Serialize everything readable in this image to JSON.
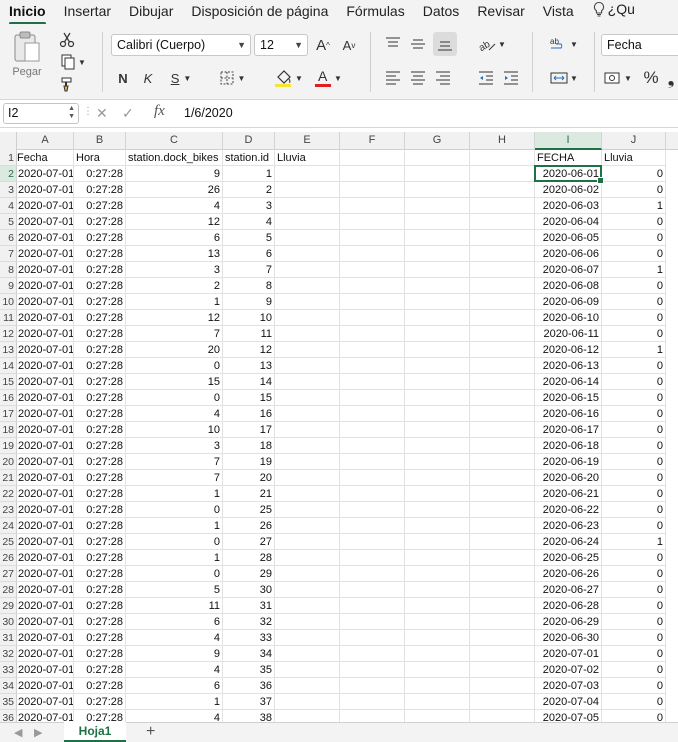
{
  "ribbon_tabs": [
    "Inicio",
    "Insertar",
    "Dibujar",
    "Disposición de página",
    "Fórmulas",
    "Datos",
    "Revisar",
    "Vista"
  ],
  "help_label": "¿Qu",
  "toolbar": {
    "paste_label": "Pegar",
    "font_name": "Calibri (Cuerpo)",
    "font_size": "12",
    "bold": "N",
    "italic": "K",
    "underline": "S",
    "number_format": "Fecha",
    "percent": "%",
    "fill_color": "#f5e52c",
    "font_color": "#e02020"
  },
  "formula_bar": {
    "cell_ref": "I2",
    "fx": "fx",
    "value": "1/6/2020"
  },
  "columns": [
    "A",
    "B",
    "C",
    "D",
    "E",
    "F",
    "G",
    "H",
    "I",
    "J"
  ],
  "selected_cell": {
    "col": "I",
    "row": 2
  },
  "header_row": [
    "Fecha",
    "Hora",
    "station.dock_bikes",
    "station.id",
    "Lluvia",
    "",
    "",
    "",
    "FECHA",
    "Lluvia"
  ],
  "rows": [
    [
      "2020-07-01",
      "0:27:28",
      "9",
      "1",
      "",
      "",
      "",
      "",
      "2020-06-01",
      "0"
    ],
    [
      "2020-07-01",
      "0:27:28",
      "26",
      "2",
      "",
      "",
      "",
      "",
      "2020-06-02",
      "0"
    ],
    [
      "2020-07-01",
      "0:27:28",
      "4",
      "3",
      "",
      "",
      "",
      "",
      "2020-06-03",
      "1"
    ],
    [
      "2020-07-01",
      "0:27:28",
      "12",
      "4",
      "",
      "",
      "",
      "",
      "2020-06-04",
      "0"
    ],
    [
      "2020-07-01",
      "0:27:28",
      "6",
      "5",
      "",
      "",
      "",
      "",
      "2020-06-05",
      "0"
    ],
    [
      "2020-07-01",
      "0:27:28",
      "13",
      "6",
      "",
      "",
      "",
      "",
      "2020-06-06",
      "0"
    ],
    [
      "2020-07-01",
      "0:27:28",
      "3",
      "7",
      "",
      "",
      "",
      "",
      "2020-06-07",
      "1"
    ],
    [
      "2020-07-01",
      "0:27:28",
      "2",
      "8",
      "",
      "",
      "",
      "",
      "2020-06-08",
      "0"
    ],
    [
      "2020-07-01",
      "0:27:28",
      "1",
      "9",
      "",
      "",
      "",
      "",
      "2020-06-09",
      "0"
    ],
    [
      "2020-07-01",
      "0:27:28",
      "12",
      "10",
      "",
      "",
      "",
      "",
      "2020-06-10",
      "0"
    ],
    [
      "2020-07-01",
      "0:27:28",
      "7",
      "11",
      "",
      "",
      "",
      "",
      "2020-06-11",
      "0"
    ],
    [
      "2020-07-01",
      "0:27:28",
      "20",
      "12",
      "",
      "",
      "",
      "",
      "2020-06-12",
      "1"
    ],
    [
      "2020-07-01",
      "0:27:28",
      "0",
      "13",
      "",
      "",
      "",
      "",
      "2020-06-13",
      "0"
    ],
    [
      "2020-07-01",
      "0:27:28",
      "15",
      "14",
      "",
      "",
      "",
      "",
      "2020-06-14",
      "0"
    ],
    [
      "2020-07-01",
      "0:27:28",
      "0",
      "15",
      "",
      "",
      "",
      "",
      "2020-06-15",
      "0"
    ],
    [
      "2020-07-01",
      "0:27:28",
      "4",
      "16",
      "",
      "",
      "",
      "",
      "2020-06-16",
      "0"
    ],
    [
      "2020-07-01",
      "0:27:28",
      "10",
      "17",
      "",
      "",
      "",
      "",
      "2020-06-17",
      "0"
    ],
    [
      "2020-07-01",
      "0:27:28",
      "3",
      "18",
      "",
      "",
      "",
      "",
      "2020-06-18",
      "0"
    ],
    [
      "2020-07-01",
      "0:27:28",
      "7",
      "19",
      "",
      "",
      "",
      "",
      "2020-06-19",
      "0"
    ],
    [
      "2020-07-01",
      "0:27:28",
      "7",
      "20",
      "",
      "",
      "",
      "",
      "2020-06-20",
      "0"
    ],
    [
      "2020-07-01",
      "0:27:28",
      "1",
      "21",
      "",
      "",
      "",
      "",
      "2020-06-21",
      "0"
    ],
    [
      "2020-07-01",
      "0:27:28",
      "0",
      "25",
      "",
      "",
      "",
      "",
      "2020-06-22",
      "0"
    ],
    [
      "2020-07-01",
      "0:27:28",
      "1",
      "26",
      "",
      "",
      "",
      "",
      "2020-06-23",
      "0"
    ],
    [
      "2020-07-01",
      "0:27:28",
      "0",
      "27",
      "",
      "",
      "",
      "",
      "2020-06-24",
      "1"
    ],
    [
      "2020-07-01",
      "0:27:28",
      "1",
      "28",
      "",
      "",
      "",
      "",
      "2020-06-25",
      "0"
    ],
    [
      "2020-07-01",
      "0:27:28",
      "0",
      "29",
      "",
      "",
      "",
      "",
      "2020-06-26",
      "0"
    ],
    [
      "2020-07-01",
      "0:27:28",
      "5",
      "30",
      "",
      "",
      "",
      "",
      "2020-06-27",
      "0"
    ],
    [
      "2020-07-01",
      "0:27:28",
      "11",
      "31",
      "",
      "",
      "",
      "",
      "2020-06-28",
      "0"
    ],
    [
      "2020-07-01",
      "0:27:28",
      "6",
      "32",
      "",
      "",
      "",
      "",
      "2020-06-29",
      "0"
    ],
    [
      "2020-07-01",
      "0:27:28",
      "4",
      "33",
      "",
      "",
      "",
      "",
      "2020-06-30",
      "0"
    ],
    [
      "2020-07-01",
      "0:27:28",
      "9",
      "34",
      "",
      "",
      "",
      "",
      "2020-07-01",
      "0"
    ],
    [
      "2020-07-01",
      "0:27:28",
      "4",
      "35",
      "",
      "",
      "",
      "",
      "2020-07-02",
      "0"
    ],
    [
      "2020-07-01",
      "0:27:28",
      "6",
      "36",
      "",
      "",
      "",
      "",
      "2020-07-03",
      "0"
    ],
    [
      "2020-07-01",
      "0:27:28",
      "1",
      "37",
      "",
      "",
      "",
      "",
      "2020-07-04",
      "0"
    ],
    [
      "2020-07-01",
      "0:27:28",
      "4",
      "38",
      "",
      "",
      "",
      "",
      "2020-07-05",
      "0"
    ]
  ],
  "sheet_tabs": [
    "Hoja1"
  ],
  "add_sheet": "+"
}
